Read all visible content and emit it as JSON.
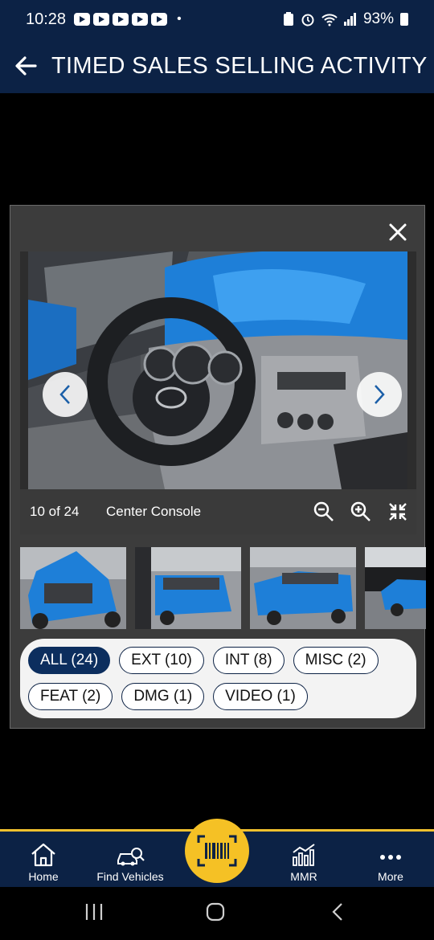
{
  "status_bar": {
    "time": "10:28",
    "battery": "93%"
  },
  "header": {
    "title": "TIMED SALES SELLING ACTIVITY"
  },
  "viewer": {
    "counter": "10 of 24",
    "caption": "Center Console"
  },
  "filters": [
    {
      "label": "ALL (24)",
      "active": true
    },
    {
      "label": "EXT (10)"
    },
    {
      "label": "INT (8)"
    },
    {
      "label": "MISC (2)"
    },
    {
      "label": "FEAT (2)"
    },
    {
      "label": "DMG (1)"
    },
    {
      "label": "VIDEO (1)"
    }
  ],
  "bottom_nav": {
    "home": "Home",
    "find": "Find Vehicles",
    "mmr": "MMR",
    "more": "More"
  },
  "colors": {
    "navy": "#0c2245",
    "accent": "#f5c125",
    "chip_active": "#0c2e5e",
    "truck_blue": "#1e7fd8"
  },
  "icons": [
    "back-arrow-icon",
    "close-icon",
    "chevron-left-icon",
    "chevron-right-icon",
    "zoom-out-icon",
    "zoom-in-icon",
    "collapse-icon",
    "home-icon",
    "find-vehicles-icon",
    "barcode-scan-icon",
    "mmr-chart-icon",
    "more-icon"
  ]
}
